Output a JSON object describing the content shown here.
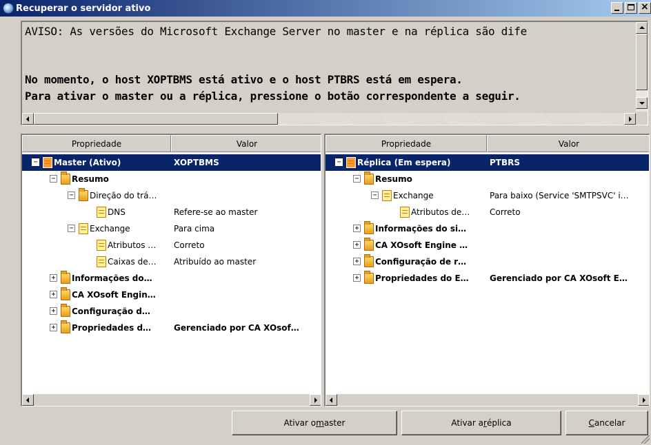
{
  "window": {
    "title": "Recuperar o servidor ativo",
    "icon": "globe-icon"
  },
  "message": {
    "line1": "AVISO: As versões do Microsoft Exchange Server no master e na réplica são dife",
    "line2": "No momento, o host XOPTBMS está ativo e o host PTBRS está em espera.",
    "line3": "Para ativar o master ou a réplica, pressione o botão correspondente a seguir."
  },
  "master_panel": {
    "headers": {
      "property": "Propriedade",
      "value": "Valor"
    },
    "rows": [
      {
        "name": "Master (Ativo)",
        "value": "XOPTBMS",
        "bold": true,
        "selected": true,
        "expander": "−",
        "icon": "doc-icon"
      },
      {
        "name": "Resumo",
        "value": "",
        "bold": true,
        "expander": "−",
        "icon": "folder-icon"
      },
      {
        "name": "Direção do trá…",
        "value": "",
        "bold": false,
        "expander": "−",
        "icon": "folder-icon"
      },
      {
        "name": "DNS",
        "value": "Refere-se ao master",
        "bold": false,
        "expander": "",
        "icon": "doc-icon"
      },
      {
        "name": "Exchange",
        "value": "Para cima",
        "bold": false,
        "expander": "−",
        "icon": "doc-icon"
      },
      {
        "name": "Atributos …",
        "value": "Correto",
        "bold": false,
        "expander": "",
        "icon": "doc-icon"
      },
      {
        "name": "Caixas de…",
        "value": "Atribuído ao master",
        "bold": false,
        "expander": "",
        "icon": "doc-icon"
      },
      {
        "name": "Informações do…",
        "value": "",
        "bold": true,
        "expander": "+",
        "icon": "folder-icon"
      },
      {
        "name": "CA XOsoft Engin…",
        "value": "",
        "bold": true,
        "expander": "+",
        "icon": "folder-icon"
      },
      {
        "name": "Configuração d…",
        "value": "",
        "bold": true,
        "expander": "+",
        "icon": "folder-icon"
      },
      {
        "name": "Propriedades d…",
        "value": "Gerenciado por CA XOsof…",
        "bold": true,
        "expander": "+",
        "icon": "folder-icon"
      }
    ]
  },
  "replica_panel": {
    "headers": {
      "property": "Propriedade",
      "value": "Valor"
    },
    "rows": [
      {
        "name": "Réplica (Em espera)",
        "value": "PTBRS",
        "bold": true,
        "selected": true,
        "expander": "−",
        "icon": "doc-icon"
      },
      {
        "name": "Resumo",
        "value": "",
        "bold": true,
        "expander": "−",
        "icon": "folder-icon"
      },
      {
        "name": "Exchange",
        "value": "Para baixo (Service 'SMTPSVC' i…",
        "bold": false,
        "expander": "−",
        "icon": "doc-icon"
      },
      {
        "name": "Atributos de…",
        "value": "Correto",
        "bold": false,
        "expander": "",
        "icon": "doc-icon"
      },
      {
        "name": "Informações do si…",
        "value": "",
        "bold": true,
        "expander": "+",
        "icon": "folder-icon"
      },
      {
        "name": "CA XOsoft Engine …",
        "value": "",
        "bold": true,
        "expander": "+",
        "icon": "folder-icon"
      },
      {
        "name": "Configuração de r…",
        "value": "",
        "bold": true,
        "expander": "+",
        "icon": "folder-icon"
      },
      {
        "name": "Propriedades do E…",
        "value": "Gerenciado por CA XOsoft E…",
        "bold": true,
        "expander": "+",
        "icon": "folder-icon"
      }
    ]
  },
  "buttons": {
    "activate_master_pre": "Ativar o ",
    "activate_master_u": "m",
    "activate_master_post": "aster",
    "activate_replica_pre": "Ativar a ",
    "activate_replica_u": "r",
    "activate_replica_post": "éplica",
    "cancel_u": "C",
    "cancel_post": "ancelar"
  },
  "colors": {
    "selection": "#0a246a",
    "face": "#d4d0c8"
  }
}
